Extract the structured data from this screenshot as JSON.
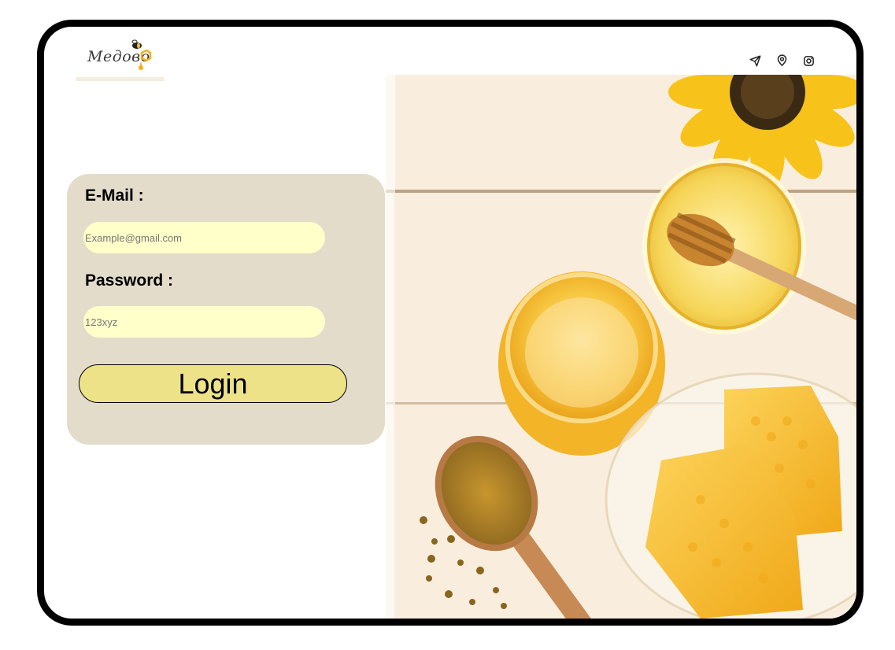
{
  "brand": {
    "logo_text": "Медово"
  },
  "header": {
    "icons": [
      "send-icon",
      "location-pin-icon",
      "instagram-icon"
    ]
  },
  "login": {
    "email_label": "E-Mail :",
    "email_placeholder": "Example@gmail.com",
    "password_label": "Password :",
    "password_placeholder": "123xyz",
    "login_button": "Login"
  },
  "colors": {
    "frame": "#000000",
    "card": "#e3dccb",
    "input_bg": "#ffffc9",
    "button_bg": "#ede287",
    "honey": "#f2b21c",
    "sunflower": "#f7c21a"
  }
}
